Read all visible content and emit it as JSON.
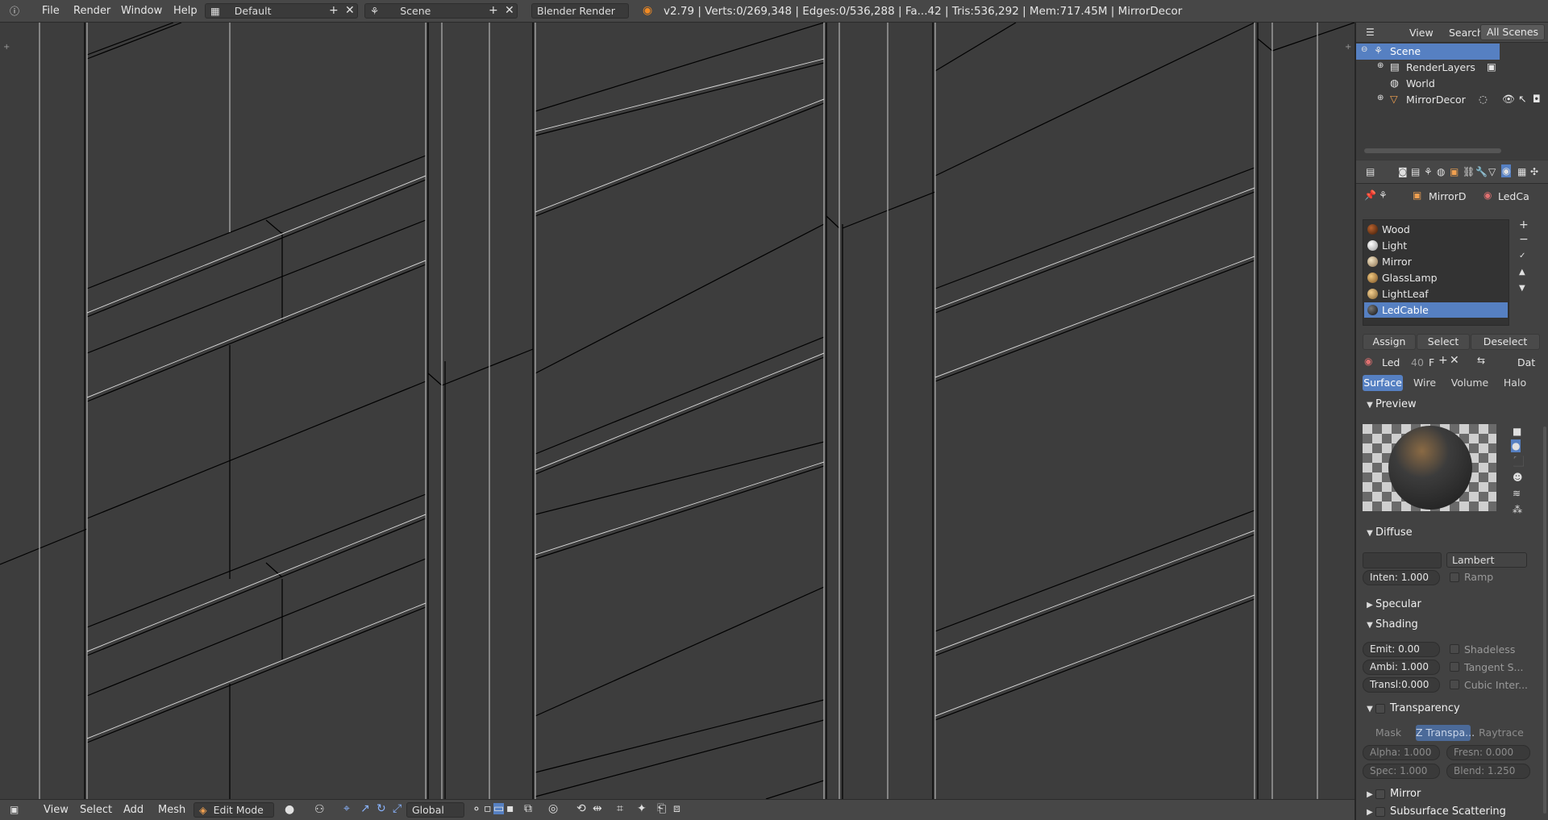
{
  "topbar": {
    "info_icon": "info-icon",
    "menu": [
      "File",
      "Render",
      "Window",
      "Help"
    ],
    "screen_layout": "Default",
    "scene": "Scene",
    "engine": "Blender Render",
    "stats": "v2.79 | Verts:0/269,348 | Edges:0/536,288 | Fa...42 | Tris:536,292 | Mem:717.45M | MirrorDecor"
  },
  "viewport": {
    "background": "#3d3d3d",
    "wire_color": "#000000",
    "object": "MirrorDecor"
  },
  "bottombar": {
    "menu": [
      "View",
      "Select",
      "Add",
      "Mesh"
    ],
    "mode": "Edit Mode",
    "orientation": "Global"
  },
  "outliner": {
    "header": {
      "view": "View",
      "search": "Search",
      "filter": "All Scenes"
    },
    "items": [
      {
        "label": "Scene",
        "icon": "scene-icon",
        "selected": true
      },
      {
        "label": "RenderLayers",
        "icon": "renderlayers-icon"
      },
      {
        "label": "World",
        "icon": "world-icon"
      },
      {
        "label": "MirrorDecor",
        "icon": "mesh-icon"
      }
    ]
  },
  "properties": {
    "context": {
      "object": "MirrorD",
      "material": "LedCa"
    },
    "materials": [
      {
        "name": "Wood",
        "color": "#7a3b1c"
      },
      {
        "name": "Light",
        "color": "#f2f2f2"
      },
      {
        "name": "Mirror",
        "color": "#e6d4b0"
      },
      {
        "name": "GlassLamp",
        "color": "#d8b070"
      },
      {
        "name": "LightLeaf",
        "color": "#e0b870"
      },
      {
        "name": "LedCable",
        "color": "#2a2a2a",
        "selected": true
      }
    ],
    "assign": "Assign",
    "select": "Select",
    "deselect": "Deselect",
    "datablock": {
      "name": "Led",
      "users": "40",
      "fake": "F",
      "data": "Dat"
    },
    "tabs": [
      {
        "label": "Surface",
        "active": true
      },
      {
        "label": "Wire"
      },
      {
        "label": "Volume"
      },
      {
        "label": "Halo"
      }
    ],
    "preview": {
      "title": "Preview"
    },
    "diffuse": {
      "title": "Diffuse",
      "shader": "Lambert",
      "intensity": "Inten: 1.000",
      "ramp": "Ramp",
      "color": "#3a3a3a"
    },
    "specular": {
      "title": "Specular"
    },
    "shading": {
      "title": "Shading",
      "emit": "Emit:  0.00",
      "ambi": "Ambi: 1.000",
      "transl": "Transl:0.000",
      "shadeless": "Shadeless",
      "tangent": "Tangent S...",
      "cubic": "Cubic Inter..."
    },
    "transparency": {
      "title": "Transparency",
      "mask": "Mask",
      "ztransp": "Z Transpa...",
      "raytrace": "Raytrace",
      "alpha": "Alpha: 1.000",
      "fresnel": "Fresn: 0.000",
      "spec": "Spec:  1.000",
      "blend": "Blend: 1.250"
    },
    "mirror": {
      "title": "Mirror"
    },
    "sss": {
      "title": "Subsurface Scattering"
    }
  }
}
